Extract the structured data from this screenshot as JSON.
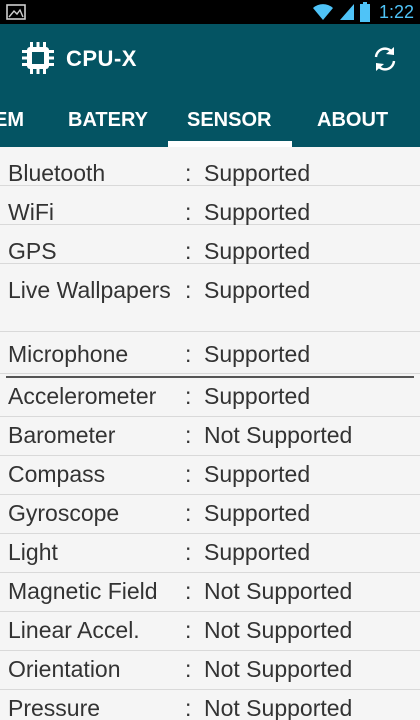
{
  "status_bar": {
    "time": "1:22",
    "icons": [
      "image-icon",
      "wifi-icon",
      "signal-icon",
      "battery-icon"
    ]
  },
  "app_bar": {
    "title": "CPU-X",
    "logo_icon": "cpu-chip-icon",
    "action_icon": "refresh-icon",
    "background": "#045463"
  },
  "tabs": [
    {
      "label": "EM"
    },
    {
      "label": "BATERY"
    },
    {
      "label": "SENSOR",
      "selected": true
    },
    {
      "label": "ABOUT"
    }
  ],
  "features": [
    {
      "name": "Bluetooth",
      "sep": ":",
      "status": "Supported"
    },
    {
      "name": "WiFi",
      "sep": ":",
      "status": "Supported"
    },
    {
      "name": "GPS",
      "sep": ":",
      "status": "Supported"
    },
    {
      "name": "Live Wallpapers",
      "sep": ":",
      "status": "Supported"
    },
    {
      "name": "Microphone",
      "sep": ":",
      "status": "Supported"
    }
  ],
  "sensors": [
    {
      "name": "Accelerometer",
      "sep": ":",
      "status": "Supported"
    },
    {
      "name": "Barometer",
      "sep": ":",
      "status": "Not Supported"
    },
    {
      "name": "Compass",
      "sep": ":",
      "status": "Supported"
    },
    {
      "name": "Gyroscope",
      "sep": ":",
      "status": "Supported"
    },
    {
      "name": "Light",
      "sep": ":",
      "status": "Supported"
    },
    {
      "name": "Magnetic Field",
      "sep": ":",
      "status": "Not Supported"
    },
    {
      "name": "Linear Accel.",
      "sep": ":",
      "status": "Not Supported"
    },
    {
      "name": "Orientation",
      "sep": ":",
      "status": "Not Supported"
    },
    {
      "name": "Pressure",
      "sep": ":",
      "status": "Not Supported"
    }
  ]
}
